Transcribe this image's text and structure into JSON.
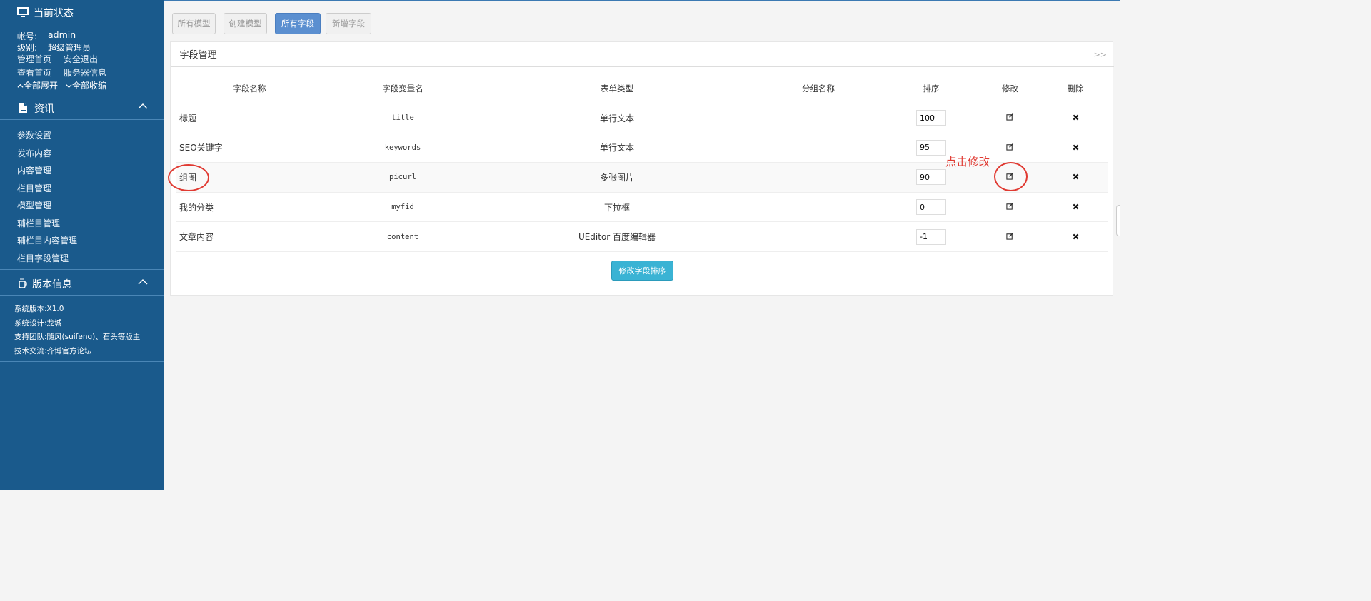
{
  "sidebar": {
    "status_title": "当前状态",
    "account_label": "帐号:",
    "account_value": "admin",
    "level_label": "级别:",
    "level_value": "超级管理员",
    "links": [
      "管理首页",
      "安全退出",
      "查看首页",
      "服务器信息"
    ],
    "expand_all": "全部展开",
    "collapse_all": "全部收缩",
    "news_title": "资讯",
    "news_items": [
      "参数设置",
      "发布内容",
      "内容管理",
      "栏目管理",
      "模型管理",
      "辅栏目管理",
      "辅栏目内容管理",
      "栏目字段管理"
    ],
    "version_title": "版本信息",
    "version": {
      "sys_ver_label": "系统版本:",
      "sys_ver_value": "X1.0",
      "design_label": "系统设计:",
      "design_value": "龙城",
      "team_label": "支持团队:",
      "team_value_1": "随风(suifeng)",
      "team_value_2": "、石头等版主",
      "forum_label": "技术交流:",
      "forum_value": "齐博官方论坛"
    }
  },
  "toolbar": {
    "buttons": [
      "所有模型",
      "创建模型",
      "所有字段",
      "新增字段"
    ],
    "active": "所有字段"
  },
  "panel": {
    "tab": "字段管理",
    "more": ">>",
    "columns": [
      "字段名称",
      "字段变量名",
      "表单类型",
      "分组名称",
      "排序",
      "修改",
      "删除"
    ],
    "rows": [
      {
        "name": "标题",
        "var": "title",
        "type": "单行文本",
        "group": "",
        "order": "100"
      },
      {
        "name": "SEO关键字",
        "var": "keywords",
        "type": "单行文本",
        "group": "",
        "order": "95"
      },
      {
        "name": "组图",
        "var": "picurl",
        "type": "多张图片",
        "group": "",
        "order": "90"
      },
      {
        "name": "我的分类",
        "var": "myfid",
        "type": "下拉框",
        "group": "",
        "order": "0"
      },
      {
        "name": "文章内容",
        "var": "content",
        "type": "UEditor 百度编辑器",
        "group": "",
        "order": "-1"
      }
    ],
    "save_button": "修改字段排序"
  },
  "annotation": {
    "text": "点击修改",
    "color": "#e03a32"
  },
  "colors": {
    "sidebar_bg": "#1a5a8c",
    "active_button": "#5b8fd0",
    "save_button": "#3ab3d4"
  }
}
